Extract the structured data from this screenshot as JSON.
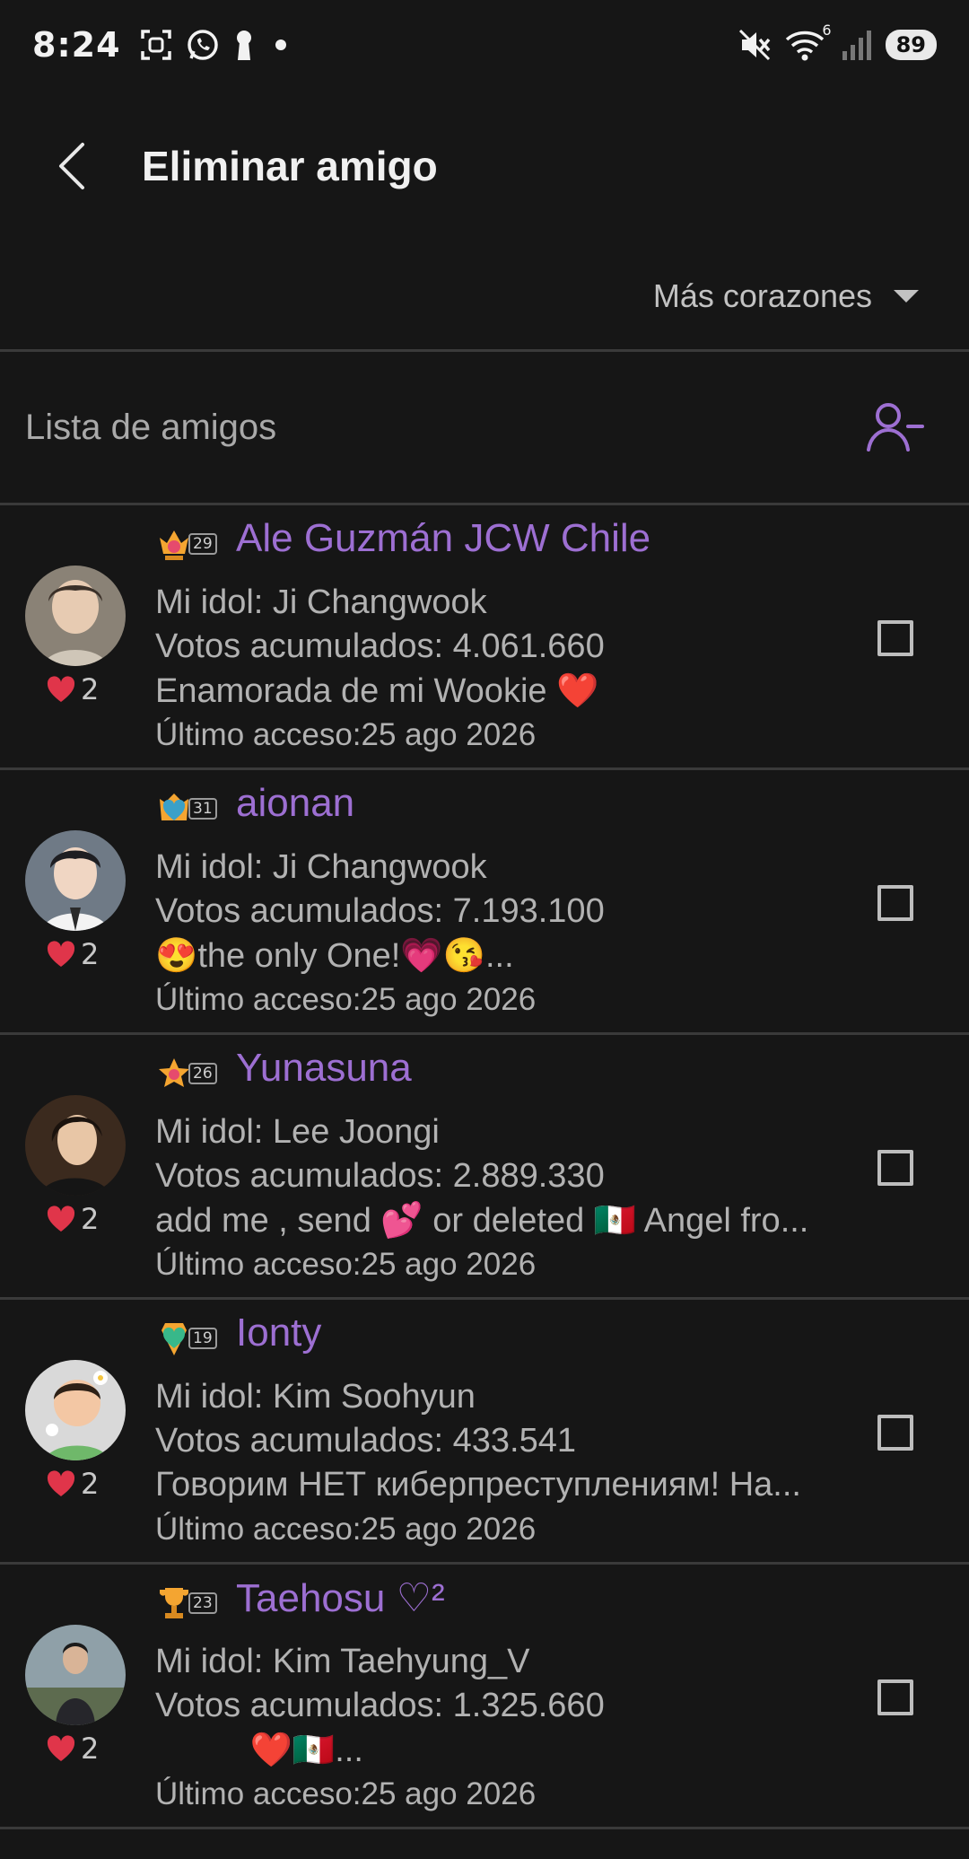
{
  "status_bar": {
    "time": "8:24",
    "battery": "89",
    "left_icons": [
      "screenshot-icon",
      "whatsapp-icon",
      "keyhole-icon",
      "dot-icon"
    ],
    "right_icons": [
      "mute-icon",
      "wifi-icon",
      "signal-icon"
    ],
    "wifi_label": "6"
  },
  "header": {
    "title": "Eliminar amigo"
  },
  "sort": {
    "selected": "Más corazones"
  },
  "list": {
    "title": "Lista de amigos"
  },
  "colors": {
    "accent": "#9d6fd2",
    "heart": "#e0354a",
    "background": "#161616"
  },
  "friends": [
    {
      "level": "29",
      "name": "Ale Guzmán JCW Chile",
      "idol": "Mi idol: Ji Changwook",
      "votes": "Votos acumulados: 4.061.660",
      "status": "Enamorada de mi Wookie ❤️",
      "last_access": "Último acceso:25 ago 2026",
      "hearts": "2"
    },
    {
      "level": "31",
      "name": "aionan",
      "idol": "Mi idol: Ji Changwook",
      "votes": "Votos acumulados: 7.193.100",
      "status": "😍the only One!💗😘...",
      "last_access": "Último acceso:25 ago 2026",
      "hearts": "2"
    },
    {
      "level": "26",
      "name": "Yunasuna",
      "idol": "Mi idol: Lee Joongi",
      "votes": "Votos acumulados: 2.889.330",
      "status": "add me , send 💕 or deleted 🇲🇽 Angel fro...",
      "last_access": "Último acceso:25 ago 2026",
      "hearts": "2"
    },
    {
      "level": "19",
      "name": "Ionty",
      "idol": "Mi idol: Kim Soohyun",
      "votes": "Votos acumulados: 433.541",
      "status": "Говорим НЕТ киберпреступлениям! На...",
      "last_access": "Último acceso:25 ago 2026",
      "hearts": "2"
    },
    {
      "level": "23",
      "name": "Taehosu ♡²",
      "idol": "Mi idol: Kim Taehyung_V",
      "votes": "Votos acumulados: 1.325.660",
      "status": "          ❤️🇲🇽...",
      "last_access": "Último acceso:25 ago 2026",
      "hearts": "2"
    }
  ]
}
